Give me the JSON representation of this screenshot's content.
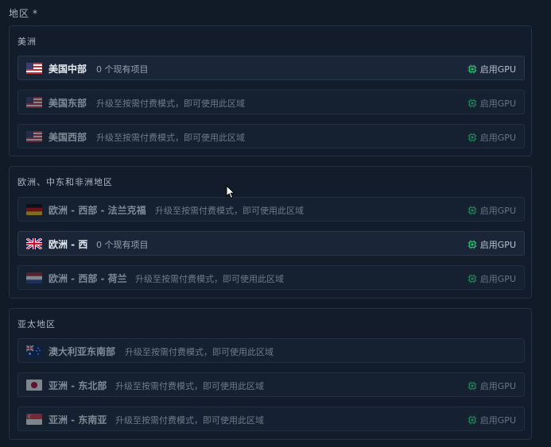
{
  "field": {
    "label": "地区",
    "required_mark": "*"
  },
  "groups": [
    {
      "title": "美洲",
      "regions": [
        {
          "name": "美国中部",
          "desc": "0 个现有项目",
          "gpu": "启用GPU"
        },
        {
          "name": "美国东部",
          "desc": "升级至按需付费模式，即可使用此区域",
          "gpu": "启用GPU"
        },
        {
          "name": "美国西部",
          "desc": "升级至按需付费模式，即可使用此区域",
          "gpu": "启用GPU"
        }
      ]
    },
    {
      "title": "欧洲、中东和非洲地区",
      "regions": [
        {
          "name": "欧洲 - 西部 - 法兰克福",
          "desc": "升级至按需付费模式，即可使用此区域",
          "gpu": "启用GPU"
        },
        {
          "name": "欧洲 - 西",
          "desc": "0 个现有项目",
          "gpu": "启用GPU"
        },
        {
          "name": "欧洲 - 西部 - 荷兰",
          "desc": "升级至按需付费模式，即可使用此区域",
          "gpu": "启用GPU"
        }
      ]
    },
    {
      "title": "亚太地区",
      "regions": [
        {
          "name": "澳大利亚东南部",
          "desc": "升级至按需付费模式，即可使用此区域"
        },
        {
          "name": "亚洲 - 东北部",
          "desc": "升级至按需付费模式，即可使用此区域",
          "gpu": "启用GPU"
        },
        {
          "name": "亚洲 - 东南亚",
          "desc": "升级至按需付费模式，即可使用此区域",
          "gpu": "启用GPU"
        }
      ]
    }
  ],
  "colors": {
    "gpu_chip": "#2fbf71",
    "background": "#111a27"
  },
  "icons": {
    "gpu": "chip-icon",
    "cursor": "mouse-pointer-icon"
  }
}
